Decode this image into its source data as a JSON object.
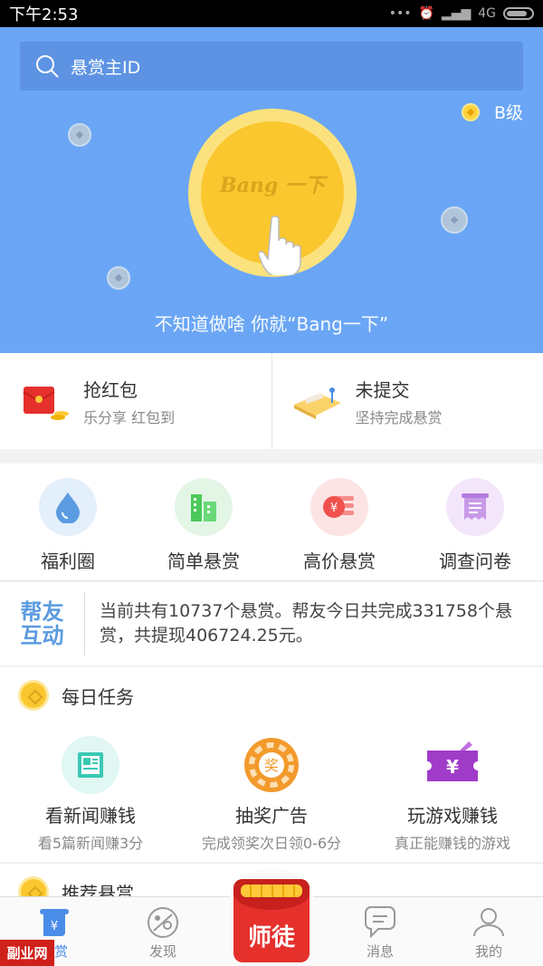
{
  "status_bar": {
    "time": "下午2:53",
    "network": "4G"
  },
  "search": {
    "placeholder": "悬赏主ID"
  },
  "level": {
    "label": "B级"
  },
  "hero": {
    "coin_text": "Bang 一下",
    "slogan": "不知道做啥 你就“Bang一下”"
  },
  "promos": [
    {
      "title": "抢红包",
      "subtitle": "乐分享 红包到"
    },
    {
      "title": "未提交",
      "subtitle": "坚持完成悬赏"
    }
  ],
  "categories": [
    {
      "label": "福利圈",
      "icon": "water-drop-icon",
      "color": "#5b9be0",
      "bg": "#e3effb"
    },
    {
      "label": "简单悬赏",
      "icon": "buildings-icon",
      "color": "#4cc95a",
      "bg": "#e3f6e6"
    },
    {
      "label": "高价悬赏",
      "icon": "yuan-coin-icon",
      "color": "#f0514f",
      "bg": "#fde4e4"
    },
    {
      "label": "调查问卷",
      "icon": "survey-scroll-icon",
      "color": "#b57be0",
      "bg": "#f3e6fb"
    }
  ],
  "stats": {
    "logo_line1": "帮友",
    "logo_line2": "互动",
    "text": "当前共有10737个悬赏。帮友今日共完成331758个悬赏，共提现406724.25元。"
  },
  "daily": {
    "title": "每日任务",
    "tasks": [
      {
        "title": "看新闻赚钱",
        "subtitle": "看5篇新闻赚3分",
        "icon": "news-icon"
      },
      {
        "title": "抽奖广告",
        "subtitle": "完成领奖次日领0-6分",
        "icon": "lottery-wheel-icon"
      },
      {
        "title": "玩游戏赚钱",
        "subtitle": "真正能赚钱的游戏",
        "icon": "game-ticket-icon"
      }
    ]
  },
  "recommend": {
    "title": "推荐悬赏"
  },
  "nav": {
    "items": [
      {
        "label": "悬赏",
        "icon": "reward-scroll-icon"
      },
      {
        "label": "发现",
        "icon": "discover-icon"
      },
      {
        "label": "师徒",
        "icon": "red-packet-icon"
      },
      {
        "label": "消息",
        "icon": "message-icon"
      },
      {
        "label": "我的",
        "icon": "profile-icon"
      }
    ]
  },
  "watermark": "副业网",
  "colors": {
    "hero_bg": "#6aa6f5",
    "accent": "#4a8de8",
    "coin": "#fbc72e",
    "packet_red": "#e5302c"
  }
}
